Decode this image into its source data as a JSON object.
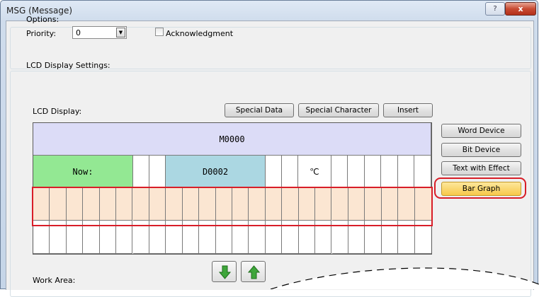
{
  "window": {
    "title": "MSG (Message)",
    "help_glyph": "?",
    "close_glyph": "x"
  },
  "options": {
    "group_label": "Options:",
    "priority_label": "Priority:",
    "priority_value": "0",
    "ack_label": "Acknowledgment",
    "ack_checked": false
  },
  "lcd_settings": {
    "group_label": "LCD Display Settings:",
    "lcd_label": "LCD Display:",
    "buttons": {
      "special_data": "Special Data",
      "special_character": "Special Character",
      "insert": "Insert"
    },
    "rows": {
      "row1": {
        "text": "M0000",
        "color": "#dcdcf7"
      },
      "row2": {
        "now": "Now:",
        "now_color": "#93e893",
        "data": "D0002",
        "data_color": "#abd7e2",
        "unit": "℃"
      },
      "row3": {
        "color": "#fbe6d2"
      }
    },
    "side_buttons": {
      "word_device": "Word Device",
      "bit_device": "Bit Device",
      "text_with_effect": "Text with Effect",
      "bar_graph": "Bar Graph"
    },
    "highlight_color": "#d81e28",
    "move_down_icon": "arrow-down-icon",
    "move_up_icon": "arrow-up-icon",
    "work_area_label": "Work Area:"
  }
}
